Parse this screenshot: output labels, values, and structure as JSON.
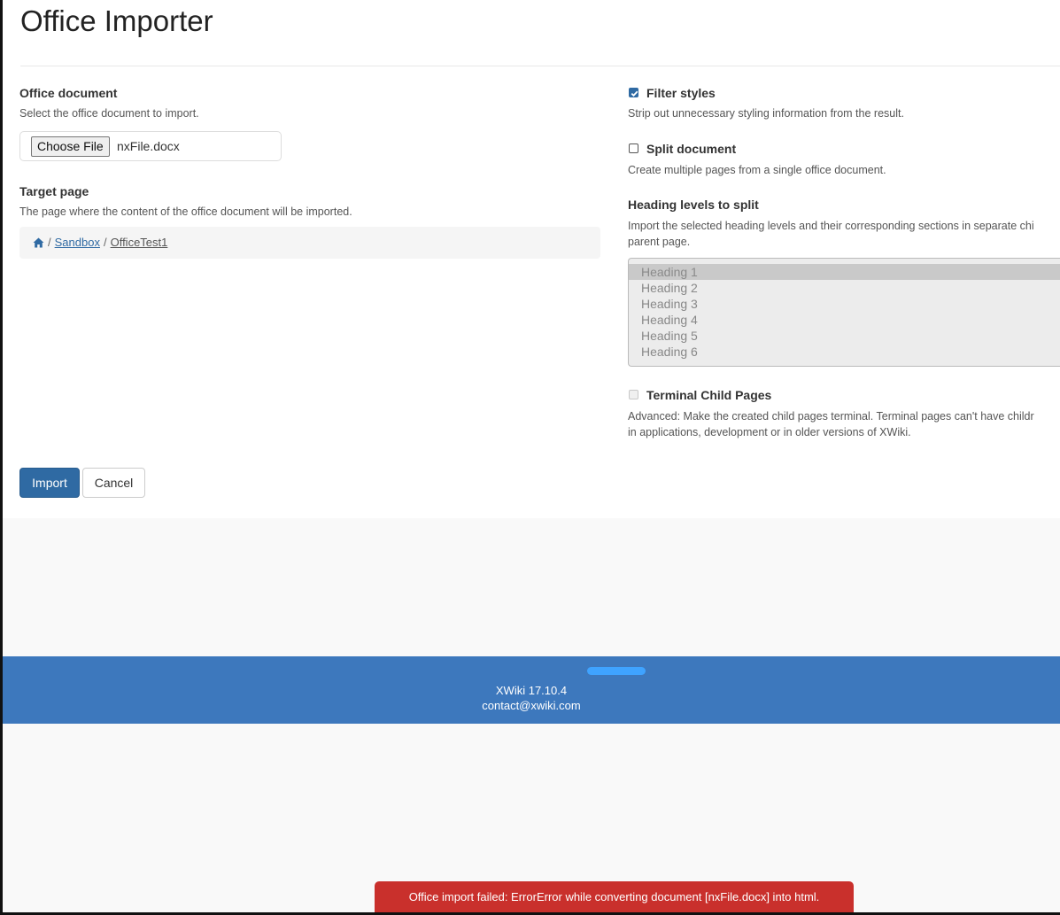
{
  "page": {
    "title": "Office Importer"
  },
  "office_document": {
    "label": "Office document",
    "hint": "Select the office document to import.",
    "choose_button": "Choose File",
    "file_name": "nxFile.docx"
  },
  "target_page": {
    "label": "Target page",
    "hint": "The page where the content of the office document will be imported.",
    "breadcrumb": [
      "Sandbox",
      "OfficeTest1"
    ],
    "home_icon": "home-icon"
  },
  "filter_styles": {
    "label": "Filter styles",
    "checked": true,
    "hint": "Strip out unnecessary styling information from the result."
  },
  "split_document": {
    "label": "Split document",
    "checked": false,
    "hint": "Create multiple pages from a single office document."
  },
  "heading_levels": {
    "label": "Heading levels to split",
    "hint_line1": "Import the selected heading levels and their corresponding sections in separate chi",
    "hint_line2": "parent page.",
    "options": [
      "Heading 1",
      "Heading 2",
      "Heading 3",
      "Heading 4",
      "Heading 5",
      "Heading 6"
    ],
    "selected": "Heading 1"
  },
  "terminal_child_pages": {
    "label": "Terminal Child Pages",
    "checked": false,
    "disabled": true,
    "hint_line1": "Advanced: Make the created child pages terminal. Terminal pages can't have childr",
    "hint_line2": "in applications, development or in older versions of XWiki."
  },
  "actions": {
    "import_label": "Import",
    "cancel_label": "Cancel"
  },
  "footer": {
    "version": "XWiki 17.10.4",
    "contact": "contact@xwiki.com"
  },
  "notification": {
    "message": "Office import failed: ErrorError while converting document [nxFile.docx] into html."
  },
  "colors": {
    "primary": "#2f6aa3",
    "footer": "#3d78bd",
    "error": "#c9302c"
  }
}
